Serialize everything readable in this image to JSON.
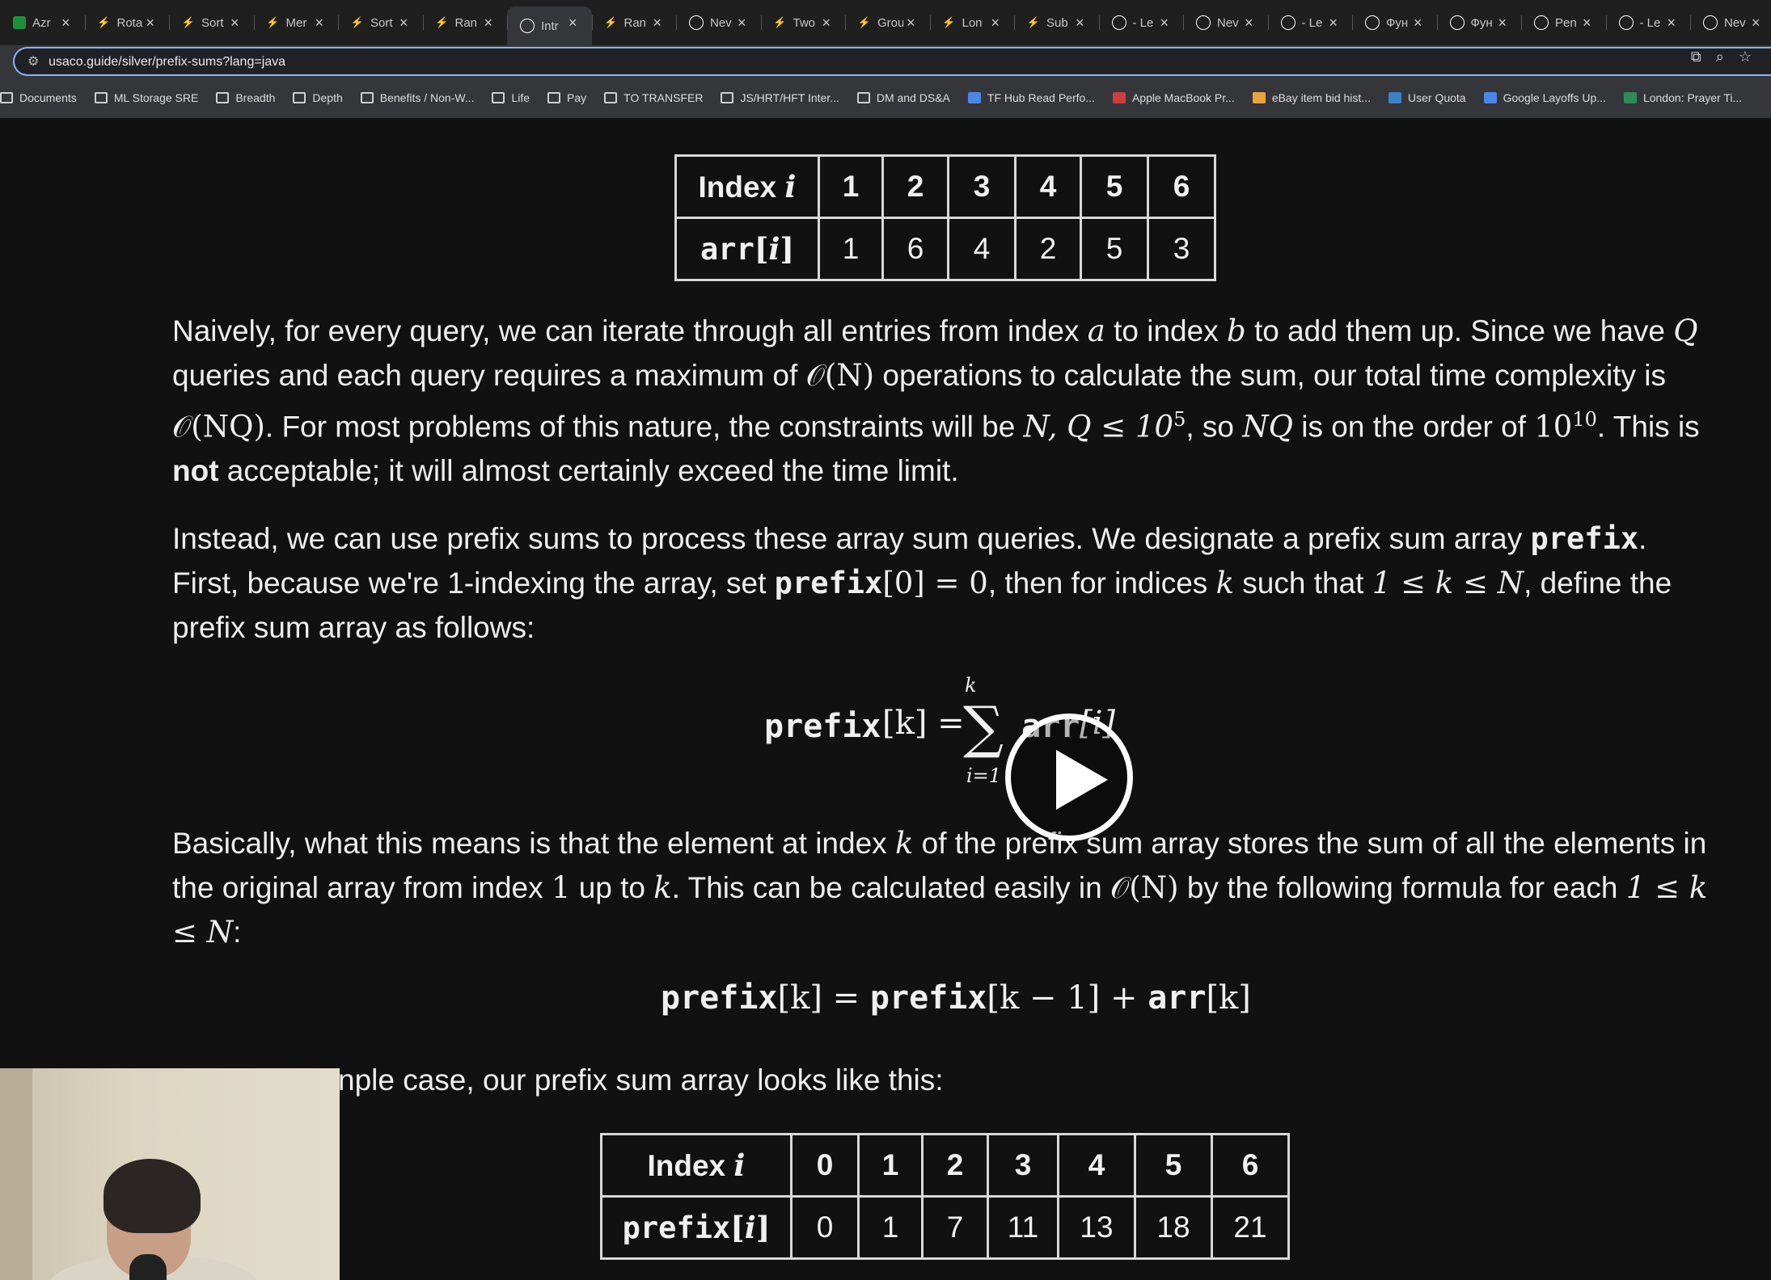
{
  "tabs": [
    {
      "label": "Azr",
      "icon": "sheets-icon",
      "color": "#1e8e3e"
    },
    {
      "label": "Rota",
      "icon": "code-icon",
      "color": "#e8a33d"
    },
    {
      "label": "Sort",
      "icon": "code-icon",
      "color": "#e8a33d"
    },
    {
      "label": "Mer",
      "icon": "code-icon",
      "color": "#e8a33d"
    },
    {
      "label": "Sort",
      "icon": "code-icon",
      "color": "#e8a33d"
    },
    {
      "label": "Ran",
      "icon": "code-icon",
      "color": "#e8a33d"
    },
    {
      "label": "Intr",
      "icon": "usaco-icon",
      "color": "#ffffff",
      "active": true
    },
    {
      "label": "Ran",
      "icon": "code-icon",
      "color": "#e8a33d"
    },
    {
      "label": "Nev",
      "icon": "openai-icon",
      "color": "#ffffff"
    },
    {
      "label": "Two",
      "icon": "code-icon",
      "color": "#e8a33d"
    },
    {
      "label": "Grou",
      "icon": "code-icon",
      "color": "#e8a33d"
    },
    {
      "label": "Lon",
      "icon": "code-icon",
      "color": "#e8a33d"
    },
    {
      "label": "Sub",
      "icon": "code-icon",
      "color": "#e8a33d"
    },
    {
      "label": "- Le",
      "icon": "leetcode-icon",
      "color": "#ffffff"
    },
    {
      "label": "Nev",
      "icon": "openai-icon",
      "color": "#ffffff"
    },
    {
      "label": "- Le",
      "icon": "leetcode-icon",
      "color": "#ffffff"
    },
    {
      "label": "Фун",
      "icon": "uk-icon",
      "color": "#ffffff"
    },
    {
      "label": "Фун",
      "icon": "uk-icon",
      "color": "#ffffff"
    },
    {
      "label": "Pen",
      "icon": "leetcode-icon",
      "color": "#ffffff"
    },
    {
      "label": "- Le",
      "icon": "leetcode-icon",
      "color": "#ffffff"
    },
    {
      "label": "Nev",
      "icon": "openai-icon",
      "color": "#ffffff"
    }
  ],
  "address": {
    "url": "usaco.guide/silver/prefix-sums?lang=java"
  },
  "bookmarks": [
    {
      "label": "Documents",
      "icon": "folder-icon"
    },
    {
      "label": "ML Storage SRE",
      "icon": "folder-icon"
    },
    {
      "label": "Breadth",
      "icon": "folder-icon"
    },
    {
      "label": "Depth",
      "icon": "folder-icon"
    },
    {
      "label": "Benefits / Non-W...",
      "icon": "folder-icon"
    },
    {
      "label": "Life",
      "icon": "folder-icon"
    },
    {
      "label": "Pay",
      "icon": "folder-icon"
    },
    {
      "label": "TO TRANSFER",
      "icon": "folder-icon"
    },
    {
      "label": "JS/HRT/HFT Inter...",
      "icon": "folder-icon"
    },
    {
      "label": "DM and DS&A",
      "icon": "folder-icon"
    },
    {
      "label": "TF Hub Read Perfo...",
      "icon": "docs-icon"
    },
    {
      "label": "Apple MacBook Pr...",
      "icon": "apple-icon"
    },
    {
      "label": "eBay item bid hist...",
      "icon": "ebay-icon"
    },
    {
      "label": "User Quota",
      "icon": "quota-icon"
    },
    {
      "label": "Google Layoffs Up...",
      "icon": "docs-icon"
    },
    {
      "label": "London: Prayer Ti...",
      "icon": "calendar-icon"
    }
  ],
  "table1": {
    "header": "Index",
    "header_var": "i",
    "row_label": "arr",
    "indices": [
      "1",
      "2",
      "3",
      "4",
      "5",
      "6"
    ],
    "values": [
      "1",
      "6",
      "4",
      "2",
      "5",
      "3"
    ]
  },
  "para1": {
    "t1": "Naively, for every query, we can iterate through all entries from index ",
    "a": "a",
    "t2": " to index ",
    "b": "b",
    "t3": " to add them up. Since we have ",
    "Q": "Q",
    "t4": " queries and each query requires a maximum of ",
    "ON": "𝒪(N)",
    "t5": " operations to calculate the sum, our total time complexity is ",
    "ONQ": "𝒪(NQ)",
    "t6": ". For most problems of this nature, the constraints will be ",
    "cons": "N, Q ≤ 10",
    "cons_exp": "5",
    "t7": ", so ",
    "NQ": "NQ",
    "t8": " is on the order of ",
    "ten": "10",
    "ten_exp": "10",
    "t9": ". This is ",
    "bold": "not",
    "t10": " acceptable; it will almost certainly exceed the time limit."
  },
  "para2": {
    "t1": "Instead, we can use prefix sums to process these array sum queries. We designate a prefix sum array ",
    "prefix": "prefix",
    "t2": ". First, because we're 1-indexing the array, set ",
    "set": "prefix",
    "set_math": "[0] = 0",
    "t3": ", then for indices ",
    "k": "k",
    "t4": " such that ",
    "range": "1 ≤ k ≤ N",
    "t5": ", define the prefix sum array as follows:"
  },
  "eq1": {
    "lhs": "prefix",
    "lhs_math": "[k] = ",
    "sum": "∑",
    "upper": "k",
    "lower": "i=1",
    "rhs": "arr",
    "rhs_math": "[i]"
  },
  "para3": {
    "t1": "Basically, what this means is that the element at index ",
    "k": "k",
    "t2": " of the prefix sum array stores the sum of all the elements in the original array from index ",
    "one": "1",
    "t3": " up to ",
    "k2": "k",
    "t4": ". This can be calculated easily in ",
    "ON": "𝒪(N)",
    "t5": " by the following formula for each ",
    "range": "1 ≤ k ≤ N",
    "t6": ":"
  },
  "eq2": {
    "a": "prefix",
    "a_math": "[k] = ",
    "b": "prefix",
    "b_math": "[k − 1] + ",
    "c": "arr",
    "c_math": "[k]"
  },
  "para4": {
    "text": "nple case, our prefix sum array looks like this:"
  },
  "table2": {
    "header": "Index",
    "header_var": "i",
    "row_label": "prefix",
    "indices": [
      "0",
      "1",
      "2",
      "3",
      "4",
      "5",
      "6"
    ],
    "values": [
      "0",
      "1",
      "7",
      "11",
      "13",
      "18",
      "21"
    ]
  }
}
